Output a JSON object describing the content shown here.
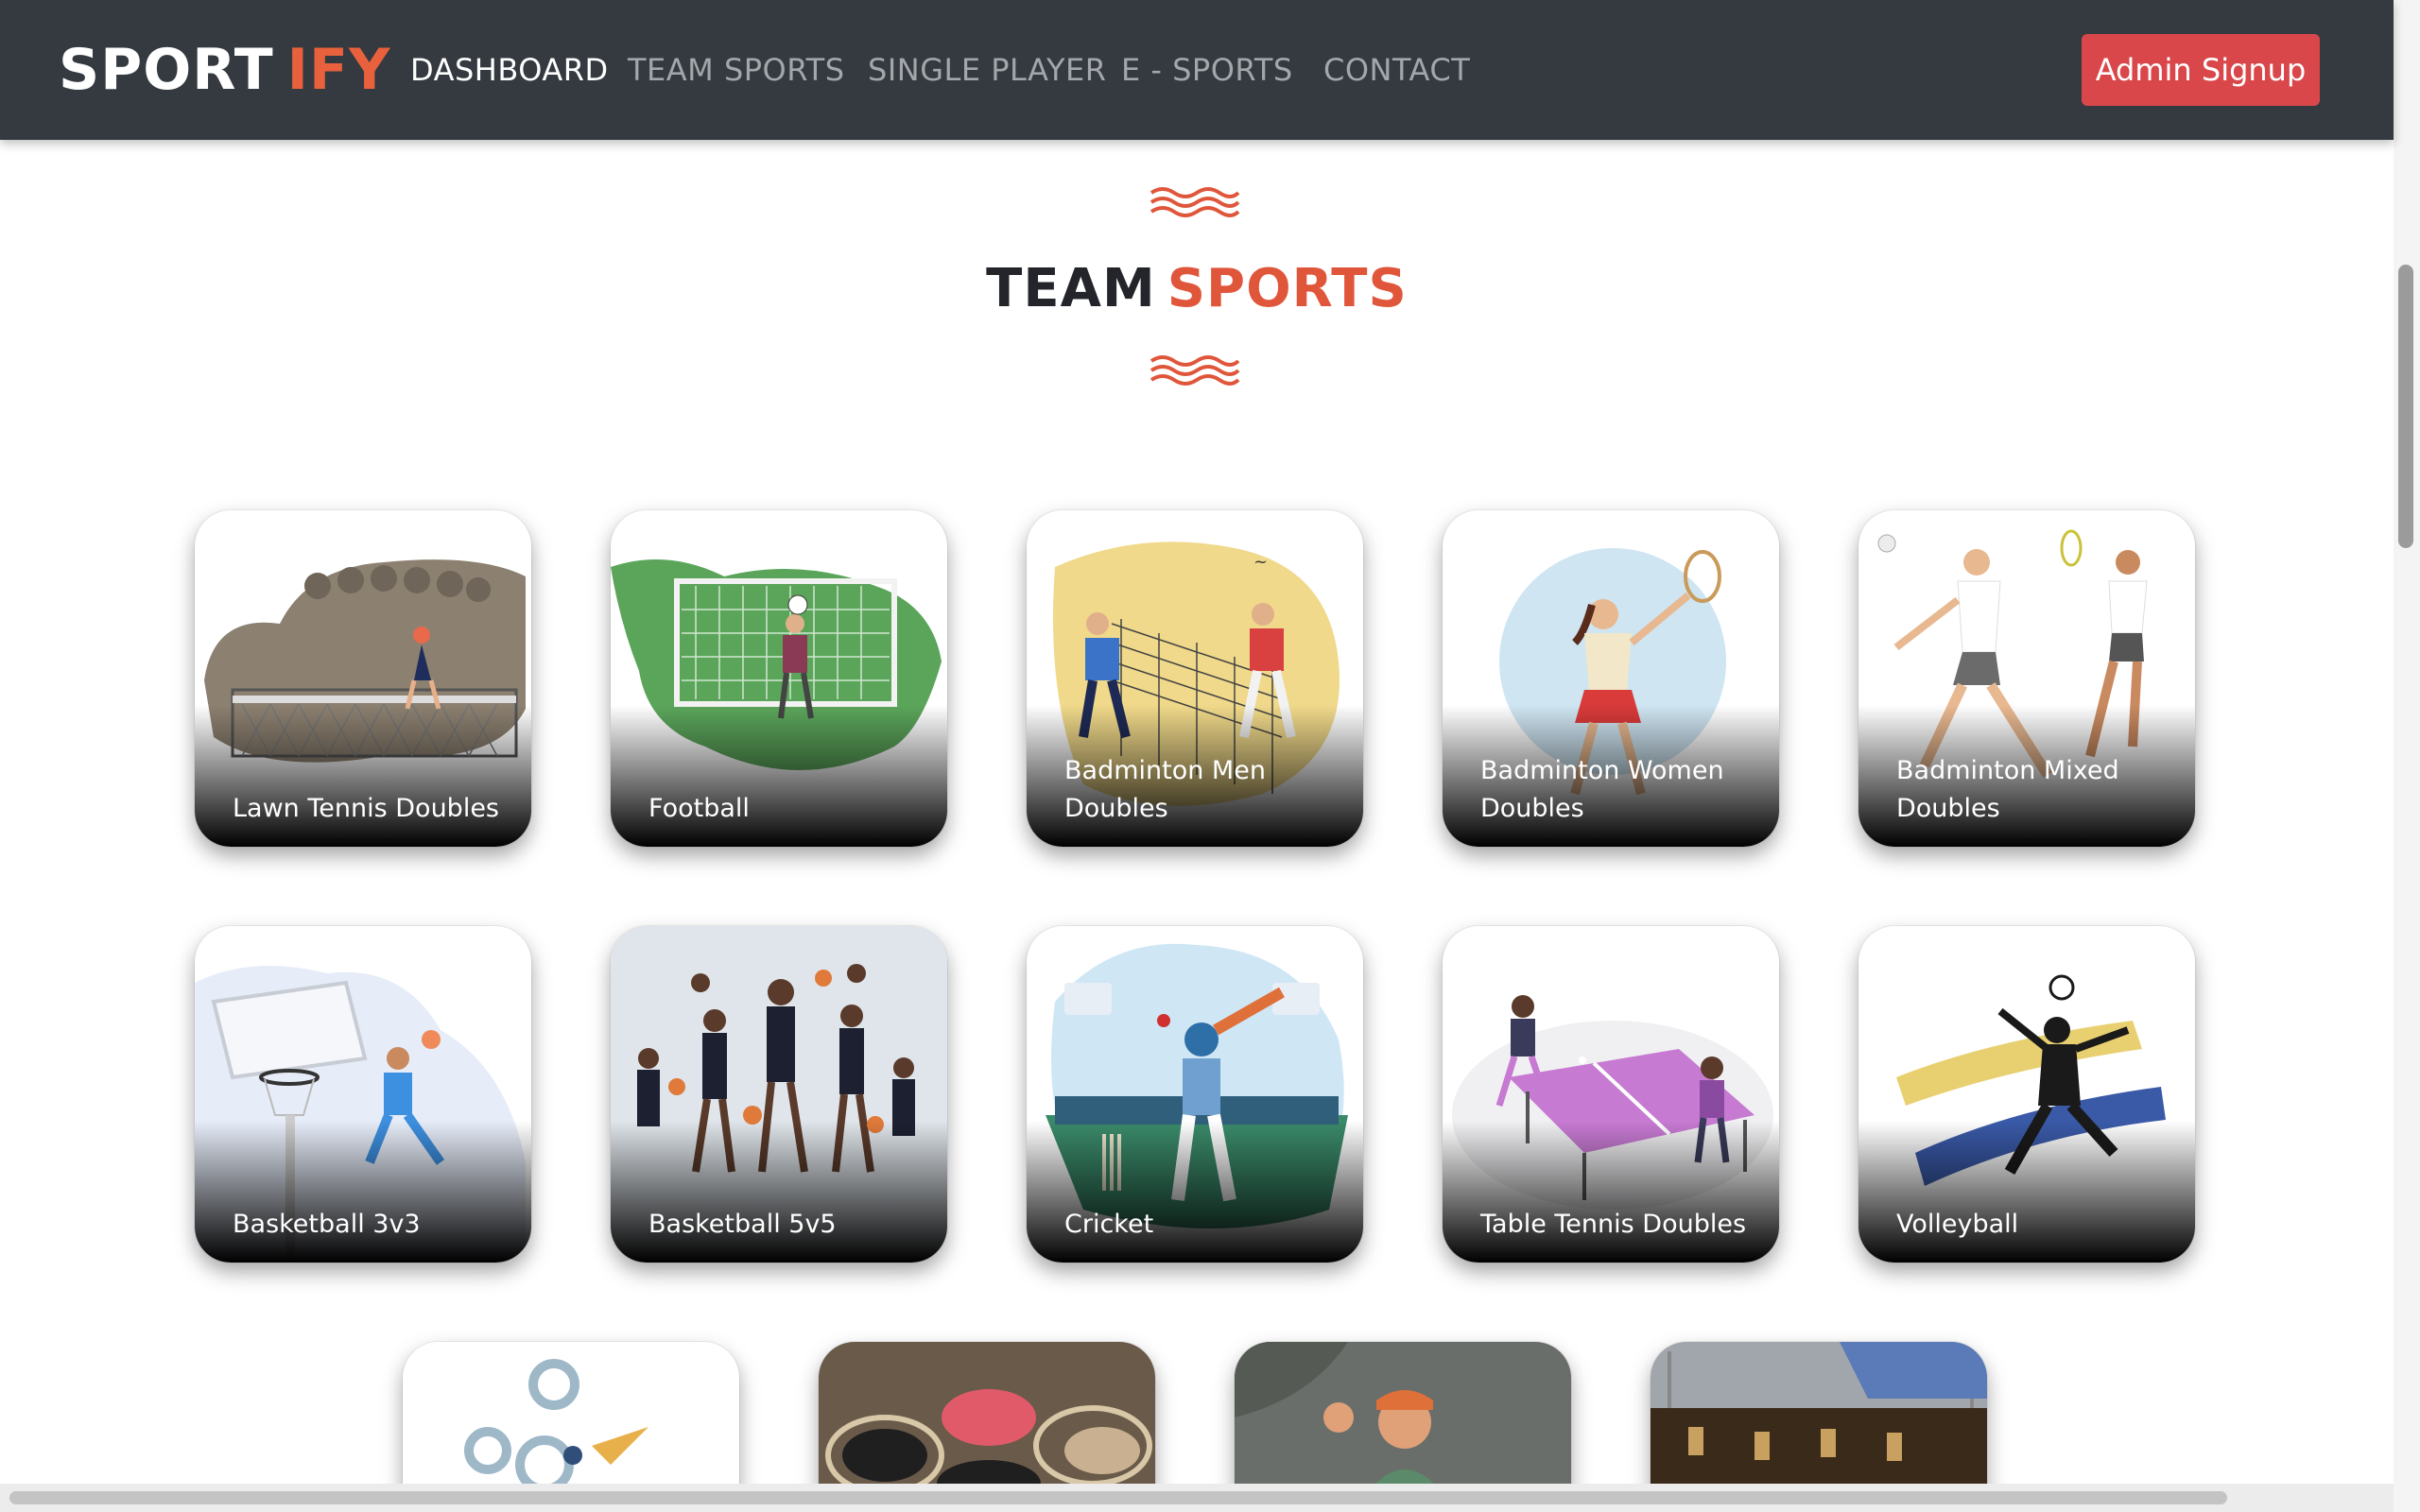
{
  "brand": {
    "part1": "SPORT",
    "part2": "IFY"
  },
  "nav": {
    "items": [
      {
        "label": "DASHBOARD",
        "active": true
      },
      {
        "label": "TEAM SPORTS",
        "active": false
      },
      {
        "label": "SINGLE PLAYER",
        "active": false
      },
      {
        "label": "E - SPORTS",
        "active": false
      },
      {
        "label": "CONTACT",
        "active": false
      }
    ],
    "admin_button": "Admin Signup"
  },
  "section": {
    "title_part1": "TEAM",
    "title_part2": "SPORTS"
  },
  "cards": [
    {
      "label": "Lawn Tennis Doubles",
      "icon": "lawn-tennis-illustration"
    },
    {
      "label": "Football",
      "icon": "football-goalkeeper-illustration"
    },
    {
      "label": "Badminton Men Doubles",
      "icon": "badminton-men-illustration"
    },
    {
      "label": "Badminton Women Doubles",
      "icon": "badminton-women-illustration"
    },
    {
      "label": "Badminton Mixed Doubles",
      "icon": "badminton-mixed-illustration"
    },
    {
      "label": "Basketball 3v3",
      "icon": "basketball-hoop-illustration"
    },
    {
      "label": "Basketball 5v5",
      "icon": "basketball-team-illustration"
    },
    {
      "label": "Cricket",
      "icon": "cricket-batsman-illustration"
    },
    {
      "label": "Table Tennis Doubles",
      "icon": "table-tennis-illustration"
    },
    {
      "label": "Volleyball",
      "icon": "volleyball-illustration"
    }
  ],
  "bottom_cards": [
    {
      "icon": "gears-illustration"
    },
    {
      "icon": "carrom-board-image"
    },
    {
      "icon": "player-photo-image"
    },
    {
      "icon": "foosball-table-image"
    }
  ],
  "colors": {
    "navbar": "#343a40",
    "accent": "#e0563b",
    "admin_button": "#d9474b",
    "title": "#23252a"
  }
}
